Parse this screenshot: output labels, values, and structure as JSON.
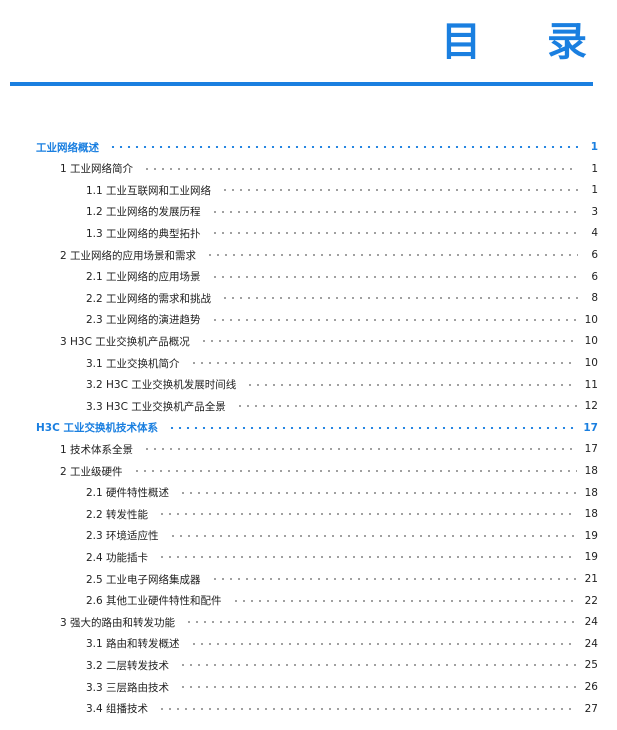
{
  "header": {
    "title": "目 录"
  },
  "toc": [
    {
      "level": 0,
      "label": "工业网络概述",
      "page": "1"
    },
    {
      "level": 1,
      "label": "1 工业网络简介",
      "page": "1"
    },
    {
      "level": 2,
      "label": "1.1 工业互联网和工业网络",
      "page": "1"
    },
    {
      "level": 2,
      "label": "1.2 工业网络的发展历程",
      "page": "3"
    },
    {
      "level": 2,
      "label": "1.3 工业网络的典型拓扑",
      "page": "4"
    },
    {
      "level": 1,
      "label": "2 工业网络的应用场景和需求",
      "page": "6"
    },
    {
      "level": 2,
      "label": "2.1 工业网络的应用场景",
      "page": "6"
    },
    {
      "level": 2,
      "label": "2.2 工业网络的需求和挑战",
      "page": "8"
    },
    {
      "level": 2,
      "label": "2.3 工业网络的演进趋势",
      "page": "10"
    },
    {
      "level": 1,
      "label": "3 H3C 工业交换机产品概况",
      "page": "10"
    },
    {
      "level": 2,
      "label": "3.1 工业交换机简介",
      "page": "10"
    },
    {
      "level": 2,
      "label": "3.2 H3C 工业交换机发展时间线",
      "page": "11"
    },
    {
      "level": 2,
      "label": "3.3 H3C 工业交换机产品全景",
      "page": "12"
    },
    {
      "level": 0,
      "label": "H3C 工业交换机技术体系",
      "page": "17"
    },
    {
      "level": 1,
      "label": "1 技术体系全景",
      "page": "17"
    },
    {
      "level": 1,
      "label": "2 工业级硬件",
      "page": "18"
    },
    {
      "level": 2,
      "label": "2.1 硬件特性概述",
      "page": "18"
    },
    {
      "level": 2,
      "label": "2.2 转发性能",
      "page": "18"
    },
    {
      "level": 2,
      "label": "2.3 环境适应性",
      "page": "19"
    },
    {
      "level": 2,
      "label": "2.4 功能插卡",
      "page": "19"
    },
    {
      "level": 2,
      "label": "2.5 工业电子网络集成器",
      "page": "21"
    },
    {
      "level": 2,
      "label": "2.6 其他工业硬件特性和配件",
      "page": "22"
    },
    {
      "level": 1,
      "label": "3 强大的路由和转发功能",
      "page": "24"
    },
    {
      "level": 2,
      "label": "3.1 路由和转发概述",
      "page": "24"
    },
    {
      "level": 2,
      "label": "3.2 二层转发技术",
      "page": "25"
    },
    {
      "level": 2,
      "label": "3.3 三层路由技术",
      "page": "26"
    },
    {
      "level": 2,
      "label": "3.4 组播技术",
      "page": "27"
    }
  ]
}
